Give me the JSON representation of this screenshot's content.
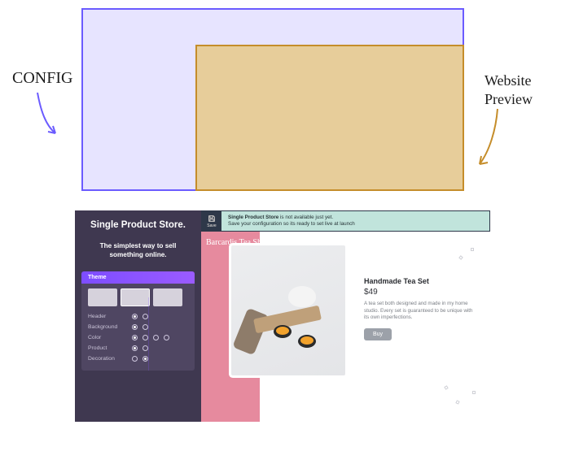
{
  "diagram": {
    "config_label": "CONFIG",
    "preview_label": "Website Preview"
  },
  "app": {
    "sidebar": {
      "title": "Single Product Store.",
      "tagline": "The simplest way to sell something online.",
      "panel_header": "Theme",
      "options": [
        {
          "label": "Header",
          "radios": [
            true,
            false
          ]
        },
        {
          "label": "Background",
          "radios": [
            true,
            false
          ]
        },
        {
          "label": "Color",
          "radios": [
            true,
            false,
            false,
            false
          ]
        },
        {
          "label": "Product",
          "radios": [
            true,
            false
          ]
        },
        {
          "label": "Decoration",
          "radios": [
            false,
            true
          ]
        }
      ]
    },
    "notif": {
      "save": "Save",
      "line1_strong": "Single Product Store",
      "line1_rest": " is not available just yet.",
      "line2": "Save your configuration so its ready to set live at launch"
    },
    "preview": {
      "shop_name": "Barcardis Tea Shop",
      "product_title": "Handmade Tea Set",
      "product_price": "$49",
      "product_desc": "A tea set both designed and made in my home studio. Every set is guaranteed to be unique with its own imperfections.",
      "buy": "Buy"
    }
  }
}
